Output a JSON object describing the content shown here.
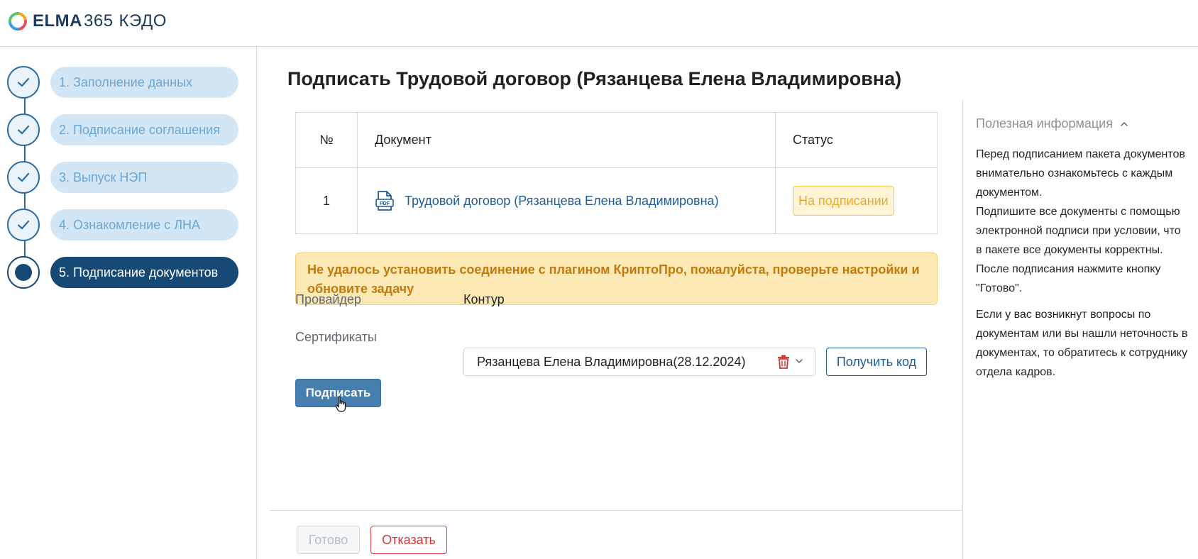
{
  "header": {
    "logo_brand": "ELMA",
    "logo_number": "365",
    "logo_product": "КЭДО"
  },
  "steps": [
    {
      "label": "1. Заполнение данных",
      "state": "done"
    },
    {
      "label": "2. Подписание соглашения",
      "state": "done"
    },
    {
      "label": "3. Выпуск НЭП",
      "state": "done"
    },
    {
      "label": "4. Ознакомление с ЛНА",
      "state": "done"
    },
    {
      "label": "5. Подписание документов",
      "state": "active"
    }
  ],
  "main": {
    "title": "Подписать Трудовой договор (Рязанцева Елена Владимировна)",
    "table": {
      "headers": {
        "num": "№",
        "document": "Документ",
        "status": "Статус"
      },
      "rows": [
        {
          "num": "1",
          "document": "Трудовой договор (Рязанцева Елена Владимировна)",
          "status": "На подписании"
        }
      ]
    },
    "alert": "Не удалось установить соединение с плагином КриптоПро, пожалуйста, проверьте настройки и обновите задачу",
    "provider": {
      "label": "Провайдер",
      "value": "Контур"
    },
    "certificates": {
      "label": "Сертификаты",
      "value": "Рязанцева Елена Владимировна(28.12.2024)"
    },
    "buttons": {
      "get_code": "Получить код",
      "sign": "Подписать",
      "done": "Готово",
      "reject": "Отказать"
    }
  },
  "info_panel": {
    "title": "Полезная информация",
    "paragraphs": [
      "Перед подписанием пакета документов внимательно ознакомьтесь с каждым документом.",
      "Подпишите все документы с помощью электронной подписи при условии, что в пакете все документы корректны.",
      "После подписания нажмите кнопку \"Готово\".",
      "Если у вас возникнут вопросы по документам или вы нашли неточность в документах, то обратитесь к сотруднику отдела кадров."
    ]
  },
  "colors": {
    "accent": "#164a75",
    "step_done_bg": "#d3e6f5",
    "link": "#1e5c96",
    "warning_bg": "#fde9b6",
    "danger": "#d23a3a"
  }
}
